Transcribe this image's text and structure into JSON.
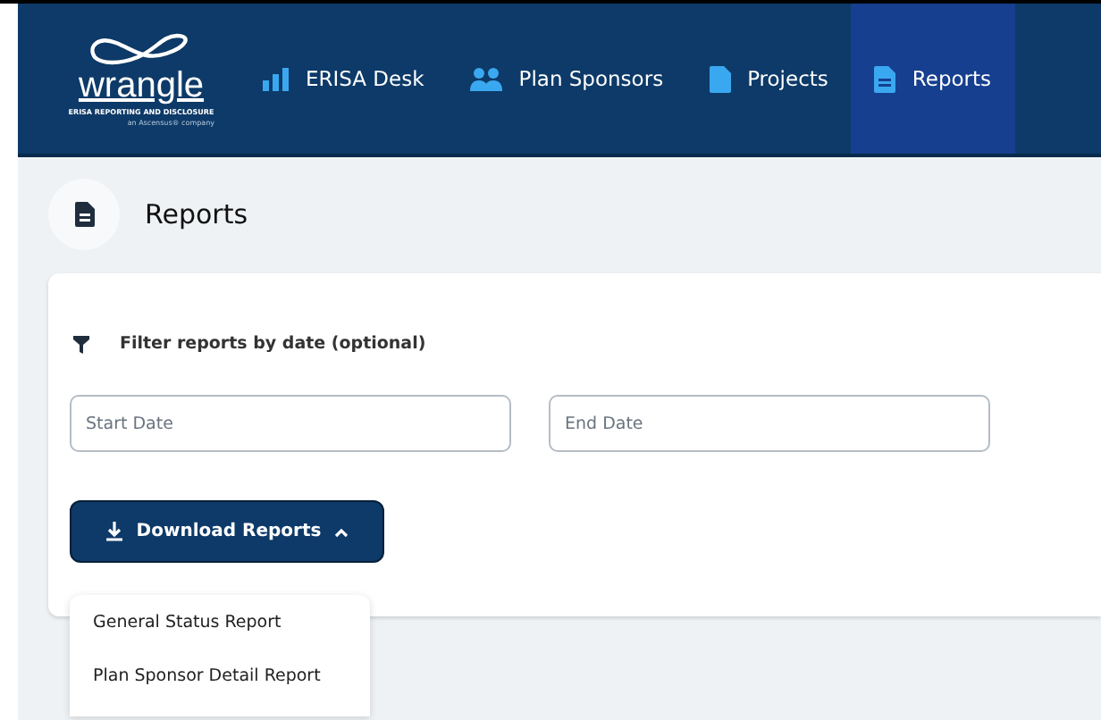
{
  "logo": {
    "wordmark": "wrangle",
    "tagline": "ERISA REPORTING AND DISCLOSURE",
    "company": "an Ascensus® company"
  },
  "nav": [
    {
      "label": "ERISA Desk",
      "kind": "bars",
      "selected": false
    },
    {
      "label": "Plan Sponsors",
      "kind": "people",
      "selected": false
    },
    {
      "label": "Projects",
      "kind": "file",
      "selected": false
    },
    {
      "label": "Reports",
      "kind": "report",
      "selected": true
    }
  ],
  "page": {
    "title": "Reports"
  },
  "filter": {
    "label": "Filter reports by date (optional)",
    "fields": [
      {
        "placeholder": "Start Date"
      },
      {
        "placeholder": "End Date"
      }
    ]
  },
  "download": {
    "label": "Download Reports",
    "expanded": true,
    "menu": [
      "General Status Report",
      "Plan Sponsor Detail Report"
    ]
  }
}
